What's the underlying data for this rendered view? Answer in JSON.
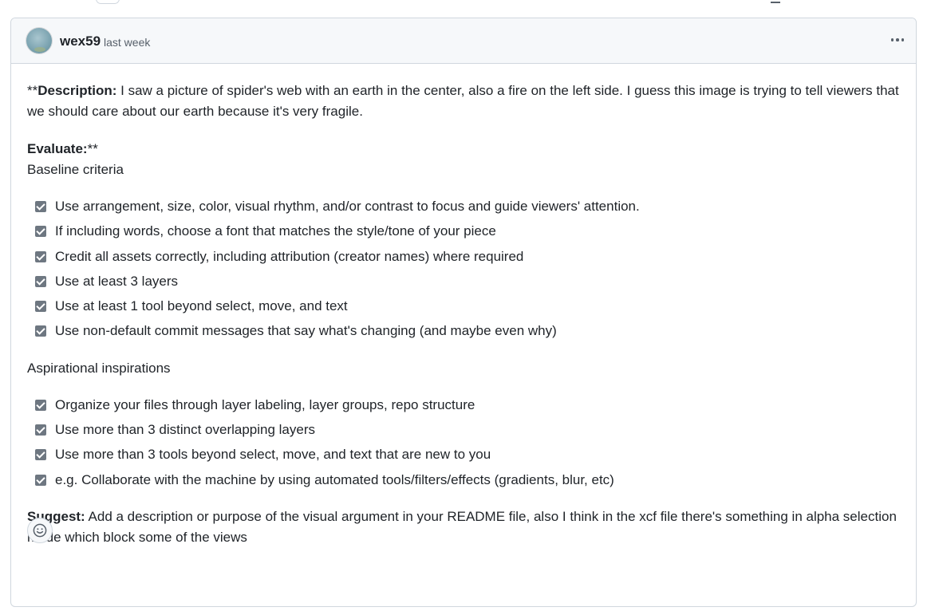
{
  "comment": {
    "author": "wex59",
    "timestamp": "last week",
    "menu_icon": "kebab-horizontal-icon",
    "description": {
      "prefix": "**",
      "label": "Description:",
      "text": " I saw a picture of spider's web with an earth in the center, also a fire on the left side. I guess this image is trying to tell viewers that we should care about our earth because it's very fragile."
    },
    "evaluate": {
      "label": "Evaluate:",
      "suffix": "**"
    },
    "baseline": {
      "heading": "Baseline criteria",
      "items": [
        {
          "label": "Use arrangement, size, color, visual rhythm, and/or contrast to focus and guide viewers' attention.",
          "checked": true
        },
        {
          "label": "If including words, choose a font that matches the style/tone of your piece",
          "checked": true
        },
        {
          "label": "Credit all assets correctly, including attribution (creator names) where required",
          "checked": true
        },
        {
          "label": "Use at least 3 layers",
          "checked": true
        },
        {
          "label": "Use at least 1 tool beyond select, move, and text",
          "checked": true
        },
        {
          "label": "Use non-default commit messages that say what's changing (and maybe even why)",
          "checked": true
        }
      ]
    },
    "aspirational": {
      "heading": "Aspirational inspirations",
      "items": [
        {
          "label": "Organize your files through layer labeling, layer groups, repo structure",
          "checked": true
        },
        {
          "label": "Use more than 3 distinct overlapping layers",
          "checked": true
        },
        {
          "label": "Use more than 3 tools beyond select, move, and text that are new to you",
          "checked": true
        },
        {
          "label": "e.g. Collaborate with the machine by using automated tools/filters/effects (gradients, blur, etc)",
          "checked": true
        }
      ]
    },
    "suggest": {
      "label": "Suggest:",
      "text": " Add a description or purpose of the visual argument in your README file, also I think in the xcf file there's something in alpha selection mode which block some of the views"
    },
    "reaction_icon": "smiley-icon"
  }
}
